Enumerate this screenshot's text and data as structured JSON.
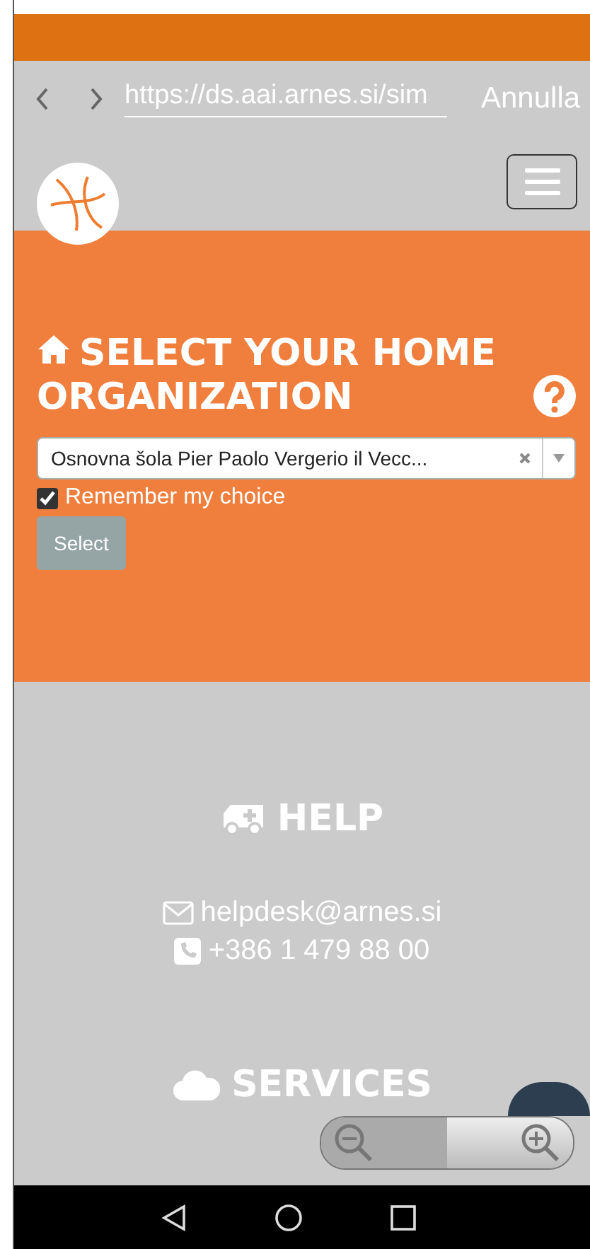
{
  "browser_bar": {
    "url": "https://ds.aai.arnes.si/sim",
    "cancel_label": "Annulla"
  },
  "organization": {
    "title": "SELECT YOUR HOME ORGANIZATION",
    "selected_value": "Osnovna šola Pier Paolo Vergerio il Vecc...",
    "remember": {
      "label": "Remember my choice",
      "checked": true
    },
    "button": "Select"
  },
  "help": {
    "title": "HELP",
    "email": "helpdesk@arnes.si",
    "phone": "+386 1 479 88 00"
  },
  "services": {
    "title": "SERVICES"
  }
}
